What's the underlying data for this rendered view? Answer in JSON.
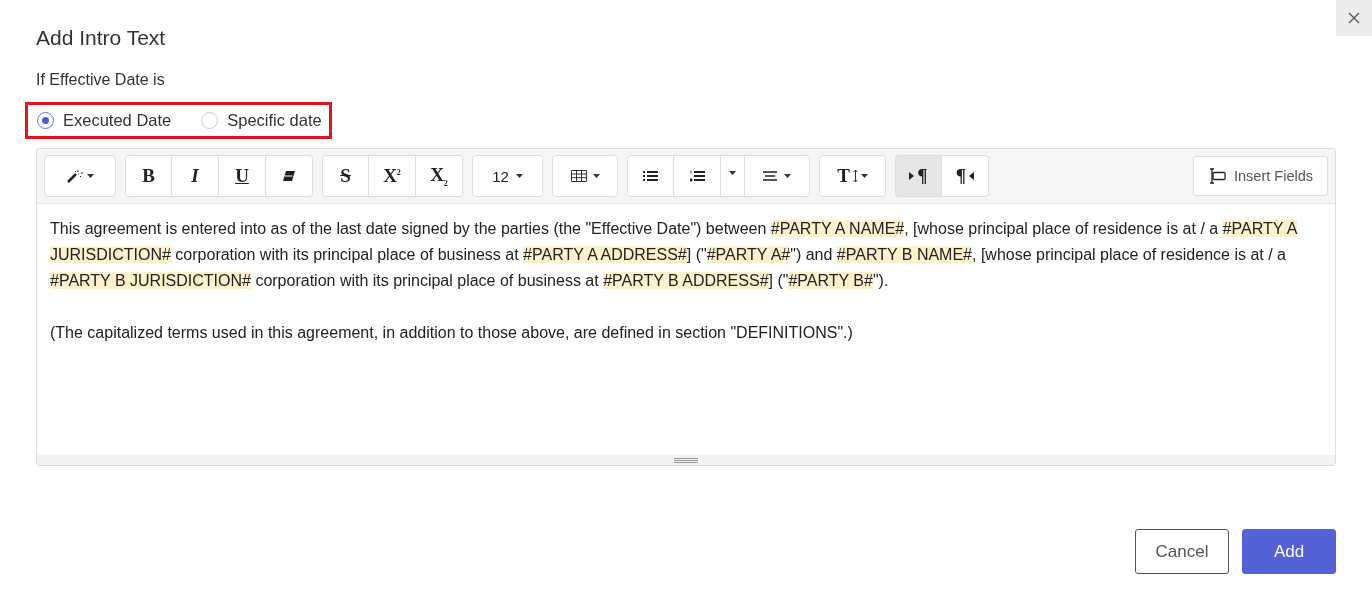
{
  "dialog": {
    "title": "Add Intro Text"
  },
  "effective_date": {
    "label": "If Effective Date is",
    "highlighted": true,
    "options": [
      {
        "label": "Executed Date",
        "selected": true
      },
      {
        "label": "Specific date",
        "selected": false
      }
    ]
  },
  "toolbar": {
    "groups": [
      [
        {
          "kind": "magic"
        }
      ],
      [
        {
          "kind": "bold",
          "glyph": "B"
        },
        {
          "kind": "italic",
          "glyph": "I"
        },
        {
          "kind": "underline",
          "glyph": "U"
        },
        {
          "kind": "eraser"
        }
      ],
      [
        {
          "kind": "strike",
          "glyph": "S"
        },
        {
          "kind": "sup",
          "glyph": "X$^{2}$"
        },
        {
          "kind": "sub",
          "glyph": "X$_{2}$"
        }
      ],
      [
        {
          "kind": "fontsize",
          "glyph": "12"
        }
      ],
      [
        {
          "kind": "table"
        }
      ],
      [
        {
          "kind": "ul"
        },
        {
          "kind": "ol"
        },
        {
          "kind": "caret"
        },
        {
          "kind": "align"
        }
      ],
      [
        {
          "kind": "lineheight",
          "glyph": "T"
        }
      ],
      [
        {
          "kind": "ltr",
          "glyph": "¶",
          "pressed": true
        },
        {
          "kind": "rtl",
          "glyph": "¶",
          "pressed": false
        }
      ]
    ],
    "insert_fields": "Insert Fields"
  },
  "editor": {
    "paragraphs": [
      [
        {
          "kind": "plain",
          "text": "This agreement is entered into as of the last date signed by the parties (the \"Effective Date\") between "
        },
        {
          "kind": "field",
          "text": "#PARTY A NAME#"
        },
        {
          "kind": "plain",
          "text": ", [whose principal place of residence is at / a "
        },
        {
          "kind": "field",
          "text": "#PARTY A JURISDICTION#"
        },
        {
          "kind": "plain",
          "text": " corporation with its principal place of business at "
        },
        {
          "kind": "field",
          "text": "#PARTY A ADDRESS#"
        },
        {
          "kind": "plain",
          "text": "] (\""
        },
        {
          "kind": "field",
          "text": "#PARTY A#"
        },
        {
          "kind": "plain",
          "text": "\") and "
        },
        {
          "kind": "field",
          "text": "#PARTY B NAME#"
        },
        {
          "kind": "plain",
          "text": ", [whose principal place of residence is at / a "
        },
        {
          "kind": "field",
          "text": "#PARTY B JURISDICTION#"
        },
        {
          "kind": "plain",
          "text": " corporation with its principal place of business at "
        },
        {
          "kind": "field",
          "text": "#PARTY B ADDRESS#"
        },
        {
          "kind": "plain",
          "text": "] (\""
        },
        {
          "kind": "field",
          "text": "#PARTY B#"
        },
        {
          "kind": "plain",
          "text": "\")."
        }
      ],
      [
        {
          "kind": "plain",
          "text": "(The capitalized terms used in this agreement, in addition to those above, are defined in section \"DEFINITIONS\".)"
        }
      ]
    ]
  },
  "buttons": [
    {
      "label": "Cancel",
      "kind": "secondary"
    },
    {
      "label": "Add",
      "kind": "primary"
    }
  ]
}
